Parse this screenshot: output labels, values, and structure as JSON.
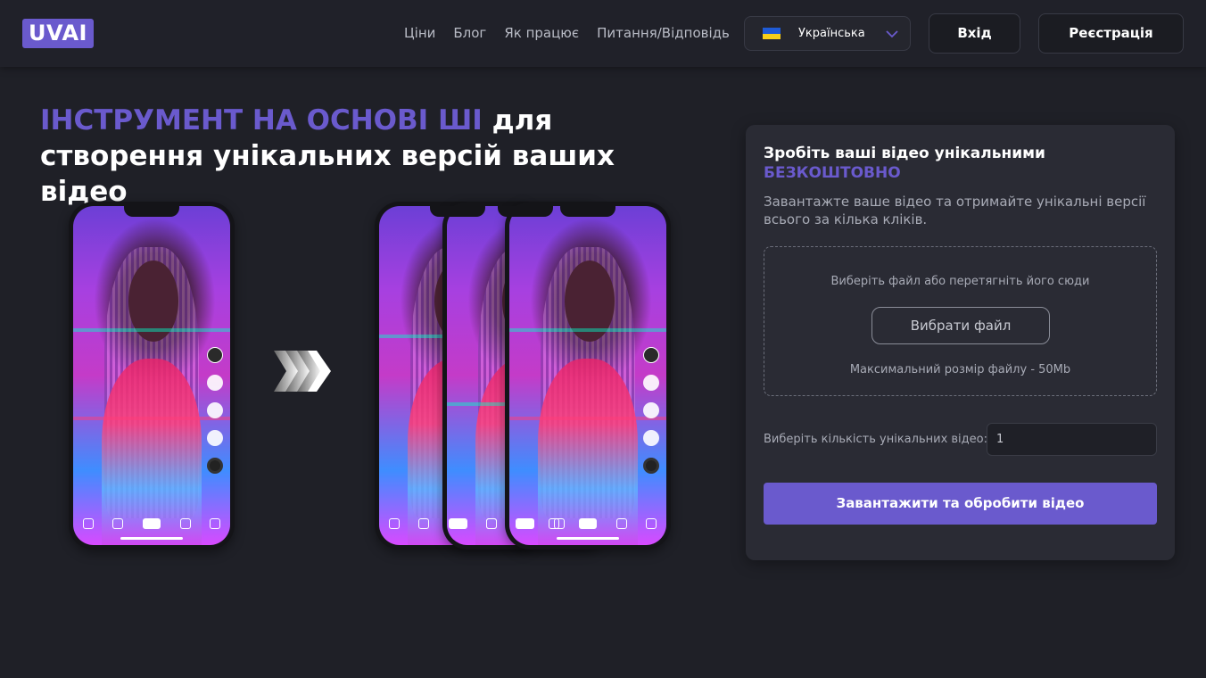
{
  "header": {
    "logo": "UVAI",
    "nav": [
      "Ціни",
      "Блог",
      "Як працює",
      "Питання/Відповідь"
    ],
    "language": {
      "label": "Українська",
      "flag_icon": "ukraine-flag-icon"
    },
    "login_label": "Вхід",
    "register_label": "Реєстрація"
  },
  "hero": {
    "title_accent": "ІНСТРУМЕНТ НА ОСНОВІ ШІ",
    "title_rest": " для створення унікальних версій ваших відео"
  },
  "card": {
    "title": "Зробіть ваші відео унікальними",
    "title_accent": "БЕЗКОШТОВНО",
    "description": "Завантажте ваше відео та отримайте унікальні версії всього за кілька кліків.",
    "drop_hint": "Виберіть файл або перетягніть його сюди",
    "choose_button": "Вибрати файл",
    "max_size": "Максимальний розмір файлу - 50Mb",
    "quantity_label": "Виберіть кількість унікальних відео:",
    "quantity_value": "1",
    "submit_button": "Завантажити та обробити відео"
  },
  "colors": {
    "accent": "#6a5acd",
    "background": "#1f2027",
    "card": "#2a2b34"
  }
}
